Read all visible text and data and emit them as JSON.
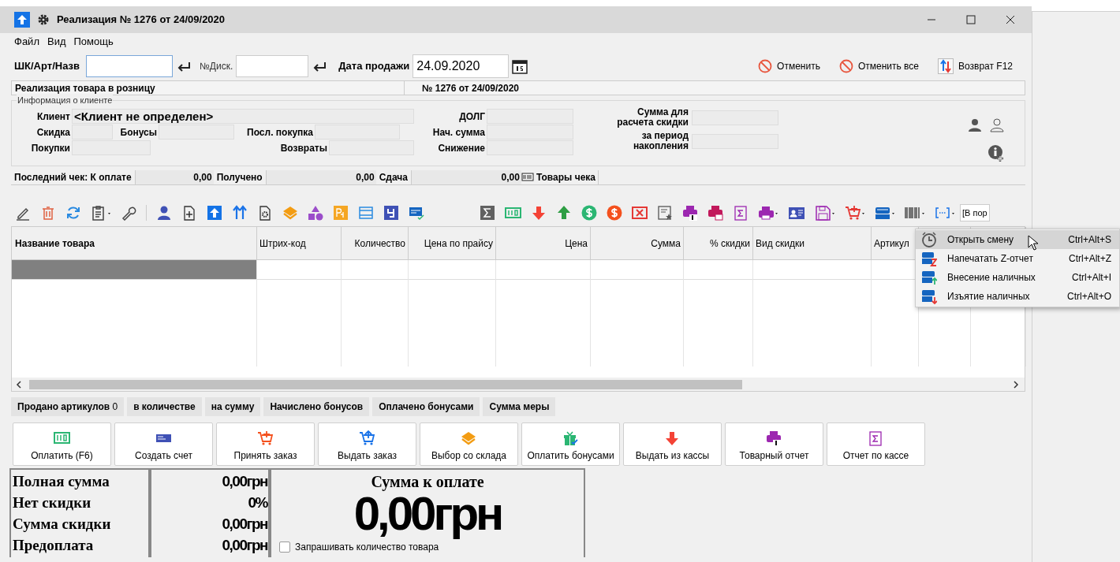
{
  "window": {
    "title": "Реализация № 1276 от 24/09/2020"
  },
  "menu": [
    "Файл",
    "Вид",
    "Помощь"
  ],
  "entry": {
    "code_label": "ШК/Арт/Назв",
    "card_label": "№Диск.",
    "date_label": "Дата продажи",
    "date_value": "24.09.2020"
  },
  "actions": [
    {
      "label": "Отменить",
      "kind": "cancel"
    },
    {
      "label": "Отменить все",
      "kind": "cancel"
    },
    {
      "label": "Возврат F12",
      "kind": "return"
    }
  ],
  "doc_header": {
    "title": "Реализация товара в розницу",
    "number": "№ 1276 от 24/09/2020"
  },
  "client": {
    "legend": "Информация о клиенте",
    "name_label": "Клиент",
    "name_value": "<Клиент не определен>",
    "discount_label": "Скидка",
    "bonus_label": "Бонусы",
    "last_purchase_label": "Посл. покупка",
    "purchases_label": "Покупки",
    "returns_label": "Возвраты",
    "debt_label": "ДОЛГ",
    "initial_sum_label": "Нач. сумма",
    "reduction_label": "Снижение",
    "discount_base_label": "Сумма для расчета скидки",
    "period_label": "за период накопления"
  },
  "last_receipt": [
    {
      "label": "Последний чек: К оплате",
      "value": "0,00"
    },
    {
      "label": "Получено",
      "value": "0,00"
    },
    {
      "label": "Сдача",
      "value": "0,00"
    }
  ],
  "receipt_goods": "Товары чека",
  "toolbar_field": "[В пор",
  "table": {
    "columns": [
      "Название товара",
      "Штрих-код",
      "Количество",
      "Цена по прайсу",
      "Цена",
      "Сумма",
      "% скидки",
      "Вид скидки",
      "Артикул"
    ]
  },
  "shift_menu": [
    {
      "label": "Открыть смену",
      "shortcut": "Ctrl+Alt+S",
      "selected": true,
      "kind": "clock"
    },
    {
      "label": "Напечатать Z-отчет",
      "shortcut": "Ctrl+Alt+Z",
      "selected": false,
      "kind": "z"
    },
    {
      "label": "Внесение наличных",
      "shortcut": "Ctrl+Alt+I",
      "selected": false,
      "kind": "in"
    },
    {
      "label": "Изъятие наличных",
      "shortcut": "Ctrl+Alt+O",
      "selected": false,
      "kind": "out"
    }
  ],
  "summary": [
    "**Продано артикулов** 0",
    "**в количестве**",
    "**на сумму**",
    "**Начислено бонусов**",
    "**Оплачено бонусами**",
    "**Сумма меры**"
  ],
  "buttons": [
    {
      "label": "Оплатить (F6)",
      "kind": "cash"
    },
    {
      "label": "Создать счет",
      "kind": "invoice"
    },
    {
      "label": "Принять заказ",
      "kind": "cart-in"
    },
    {
      "label": "Выдать заказ",
      "kind": "cart-out"
    },
    {
      "label": "Выбор со склада",
      "kind": "layers"
    },
    {
      "label": "Оплатить бонусами",
      "kind": "gift"
    },
    {
      "label": "Выдать из кассы",
      "kind": "down"
    },
    {
      "label": "Товарный отчет",
      "kind": "printer"
    },
    {
      "label": "Отчет по кассе",
      "kind": "sigma"
    }
  ],
  "totals": [
    {
      "label": "Полная сумма",
      "value": "0,00грн"
    },
    {
      "label": "Нет скидки",
      "value": "0%"
    },
    {
      "label": "Сумма скидки",
      "value": "0,00грн"
    },
    {
      "label": "Предоплата",
      "value": "0,00грн"
    }
  ],
  "payment": {
    "title": "Сумма к оплате",
    "amount": "0,00грн",
    "ask_quantity": {
      "label": "Запрашивать количество товара",
      "checked": false
    }
  }
}
